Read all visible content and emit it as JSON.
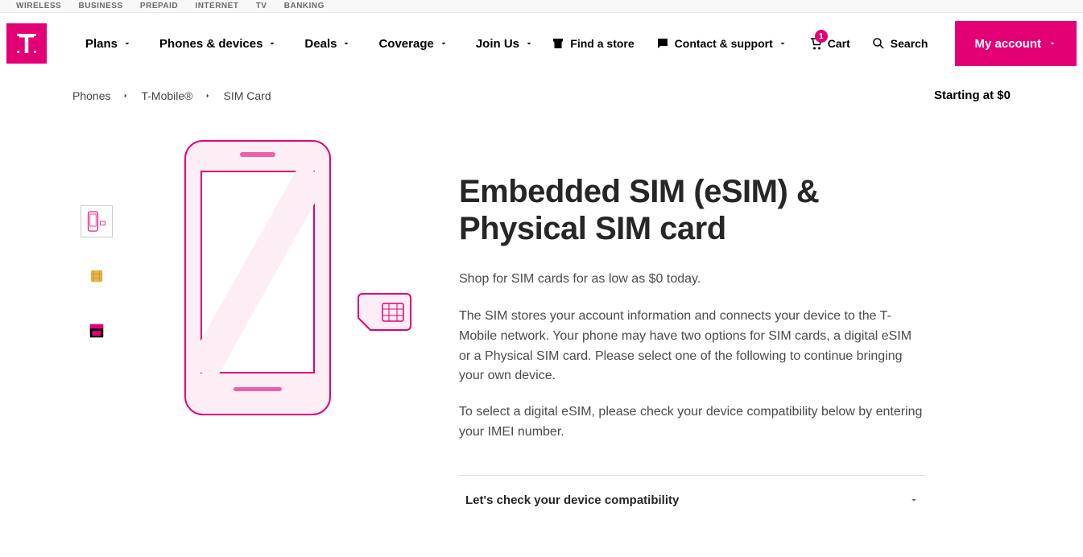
{
  "top_bar": [
    "WIRELESS",
    "BUSINESS",
    "PREPAID",
    "INTERNET",
    "TV",
    "BANKING"
  ],
  "nav": {
    "items": [
      "Plans",
      "Phones & devices",
      "Deals",
      "Coverage",
      "Join Us"
    ],
    "find_store": "Find a store",
    "contact": "Contact & support",
    "cart": "Cart",
    "cart_count": "1",
    "search": "Search",
    "account": "My account"
  },
  "breadcrumb": [
    "Phones",
    "T-Mobile®",
    "SIM Card"
  ],
  "starting_at": "Starting at $0",
  "product": {
    "title": "Embedded SIM (eSIM) & Physical SIM card",
    "subtitle": "Shop for SIM cards for as low as $0 today.",
    "desc1": "The SIM stores your account information and connects your device to the T-Mobile network. Your phone may have two options for SIM cards, a digital eSIM or a Physical SIM card. Please select one of the following to continue bringing your own device.",
    "desc2": "To select a digital eSIM, please check your device compatibility below by entering your IMEI number.",
    "accordion": "Let's check your device compatibility"
  },
  "colors": {
    "brand": "#e20074"
  }
}
